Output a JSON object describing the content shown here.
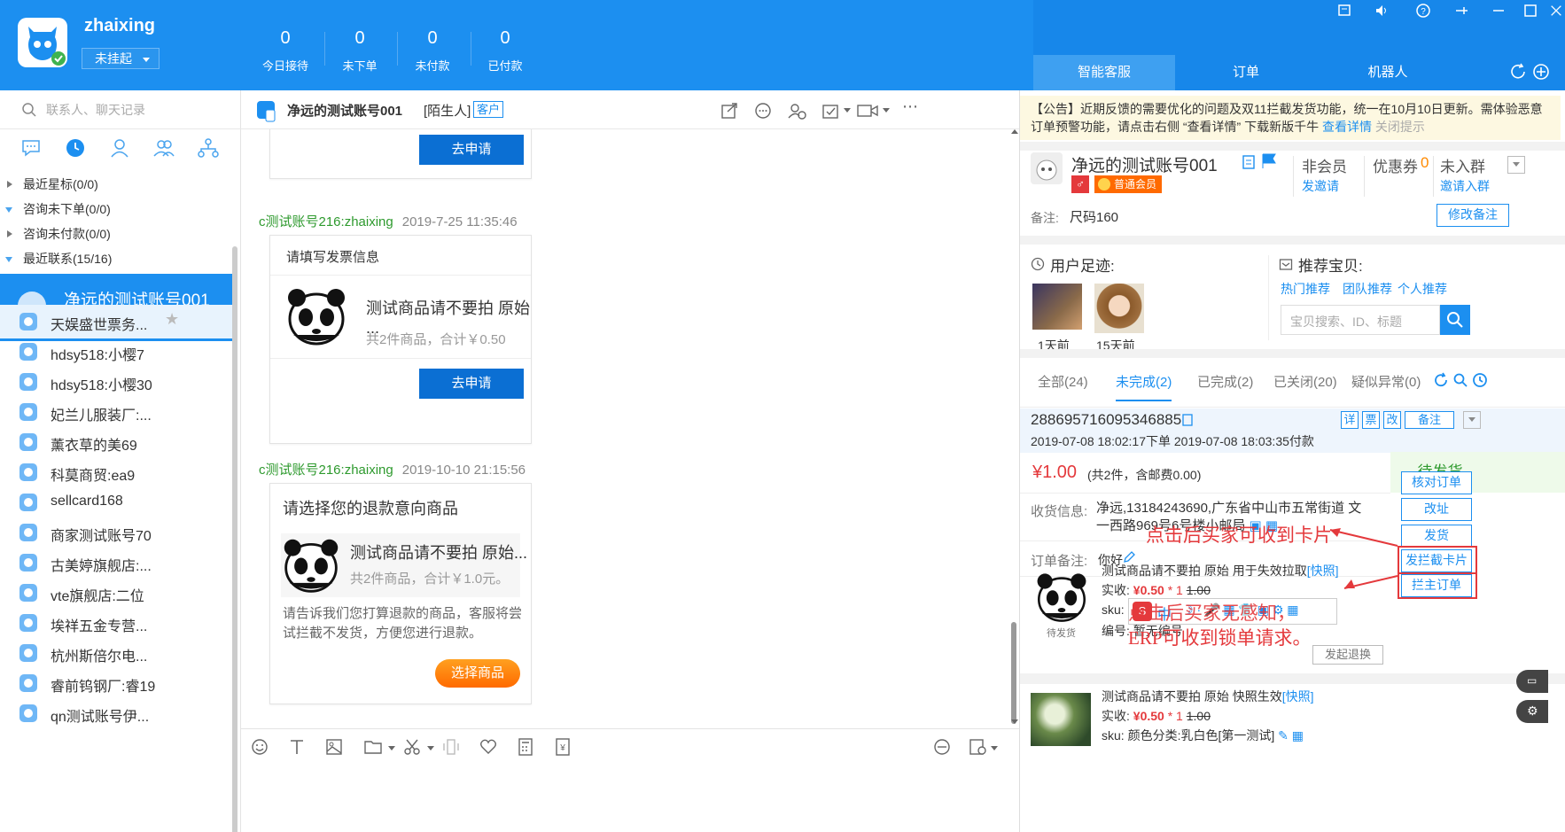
{
  "header": {
    "username": "zhaixing",
    "status": "未挂起",
    "stats": [
      {
        "value": "0",
        "label": "今日接待"
      },
      {
        "value": "0",
        "label": "未下单"
      },
      {
        "value": "0",
        "label": "未付款"
      },
      {
        "value": "0",
        "label": "已付款"
      }
    ],
    "right_tabs": [
      "智能客服",
      "订单",
      "机器人"
    ],
    "accent": "#1c8ff0"
  },
  "left": {
    "search_placeholder": "联系人、聊天记录",
    "nav_icons": [
      "chat-icon",
      "clock-icon",
      "user-icon",
      "users-icon",
      "org-icon"
    ],
    "groups": [
      "最近星标(0/0)",
      "咨询未下单(0/0)",
      "咨询未付款(0/0)",
      "最近联系(15/16)"
    ],
    "active_contact": "净远的测试账号001",
    "contacts": [
      "天娱盛世票务...",
      "hdsy518:小樱7",
      "hdsy518:小樱30",
      "妃兰儿服装厂:...",
      "薰衣草的美69",
      "科莫商贸:ea9",
      "sellcard168",
      "商家测试账号70",
      "古美婷旗舰店:...",
      "vte旗舰店:二位",
      "埃祥五金专营...",
      "杭州斯倍尔电...",
      "睿前钨钢厂:睿19",
      "qn测试账号伊..."
    ]
  },
  "chat": {
    "title": "净远的测试账号001",
    "stranger": "[陌生人]",
    "tag": "客户",
    "apply_label": "去申请",
    "msg1": {
      "sender": "c测试账号216:zhaixing",
      "time": "2019-7-25 11:35:46",
      "header": "请填写发票信息",
      "product": "测试商品请不要拍 原始 ...",
      "summary": "共2件商品，合计￥0.50",
      "button": "去申请"
    },
    "msg2": {
      "sender": "c测试账号216:zhaixing",
      "time": "2019-10-10 21:15:56",
      "header": "请选择您的退款意向商品",
      "product": "测试商品请不要拍 原始...",
      "summary": "共2件商品，合计￥1.0元。",
      "desc": "请告诉我们您打算退款的商品，客服将尝试拦截不发货，方便您进行退款。",
      "button": "选择商品"
    }
  },
  "right": {
    "notice": "【公告】近期反馈的需要优化的问题及双11拦截发货功能，统一在10月10日更新。需体验恶意订单预警功能，请点击右侧 “查看详情” 下载新版千牛",
    "notice_link": "查看详情",
    "notice_close": "关闭提示",
    "customer_name": "净远的测试账号001",
    "member_badge": "普通会员",
    "nonmember": "非会员",
    "invite": "发邀请",
    "coupon_label": "优惠券",
    "coupon_count": "0",
    "not_in_group": "未入群",
    "invite_group": "邀请入群",
    "remark_label": "备注:",
    "remark_value": "尺码160",
    "edit_remark": "修改备注",
    "footprint_title": "用户足迹:",
    "footprints": [
      "1天前",
      "15天前"
    ],
    "recommend_title": "推荐宝贝:",
    "recommend_tabs": [
      "热门推荐",
      "团队推荐",
      "个人推荐"
    ],
    "search_placeholder": "宝贝搜索、ID、标题",
    "order_tabs": [
      "全部(24)",
      "未完成(2)",
      "已完成(2)",
      "已关闭(20)",
      "疑似异常(0)"
    ],
    "order": {
      "id": "2886957160953468 85",
      "time": "2019-07-08 18:02:17下单 2019-07-08 18:03:35付款",
      "price": "¥1.00",
      "price_detail": "(共2件，含邮费0.00)",
      "status": "待发货",
      "address_label": "收货信息:",
      "address": "净远,13184243690,广东省中山市五常街道 文 一西路969号6号楼小邮局",
      "note_label": "订单备注:",
      "note_value": "你好",
      "actions": [
        "核对订单",
        "改址",
        "发货",
        "发拦截卡片",
        "拦主订单"
      ],
      "icons": [
        "详",
        "票",
        "改",
        "备注"
      ],
      "item1": {
        "title": "测试商品请不要拍 原始 用于失效拉取",
        "snapshot": "[快照]",
        "paid_label": "实收:",
        "paid": "¥0.50",
        "qty": "* 1",
        "orig": "1.00",
        "sku_label": "sku:",
        "code_label": "编号:",
        "code": "暂无编号",
        "status": "待发货",
        "refund": "发起退换"
      },
      "item2": {
        "title": "测试商品请不要拍 原始 快照生效",
        "snapshot": "[快照]",
        "paid_label": "实收:",
        "paid": "¥0.50",
        "qty": "* 1",
        "orig": "1.00",
        "sku_label": "sku:",
        "sku": "颜色分类:乳白色[第一测试]"
      }
    },
    "annotation1": "点击后买家可收到卡片",
    "annotation2a": "点击后买家无感知，",
    "annotation2b": "ERP可收到锁单请求。",
    "ime_label": "中"
  }
}
